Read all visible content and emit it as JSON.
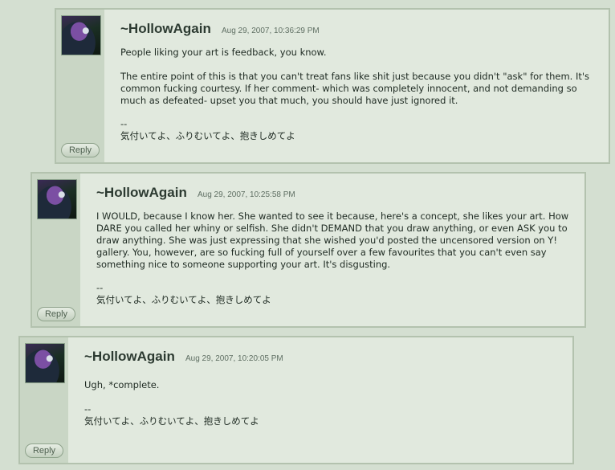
{
  "comments": [
    {
      "author": "~HollowAgain",
      "date": "Aug 29, 2007, 10:36:29 PM",
      "paragraphs": [
        "People liking your art is feedback, you know.",
        "The entire point of this is that you can't treat fans like shit just because you didn't \"ask\" for them. It's common fucking courtesy. If her comment- which was completely innocent, and not demanding so much as defeated- upset you that much, you should have just ignored it."
      ],
      "sig_sep": "--",
      "sig": "気付いてよ、ふりむいてよ、抱きしめてよ",
      "reply": "Reply"
    },
    {
      "author": "~HollowAgain",
      "date": "Aug 29, 2007, 10:25:58 PM",
      "paragraphs": [
        "I WOULD, because I know her. She wanted to see it because, here's a concept, she likes your art. How DARE you called her whiny or selfish. She didn't DEMAND that you draw anything, or even ASK you to draw anything. She was just expressing that she wished you'd posted the uncensored version on Y! gallery. You, however, are so fucking full of yourself over a few favourites that you can't even say something nice to someone supporting your art. It's disgusting."
      ],
      "sig_sep": "--",
      "sig": "気付いてよ、ふりむいてよ、抱きしめてよ",
      "reply": "Reply"
    },
    {
      "author": "~HollowAgain",
      "date": "Aug 29, 2007, 10:20:05 PM",
      "paragraphs": [
        "Ugh, *complete."
      ],
      "sig_sep": "--",
      "sig": "気付いてよ、ふりむいてよ、抱きしめてよ",
      "reply": "Reply"
    }
  ]
}
